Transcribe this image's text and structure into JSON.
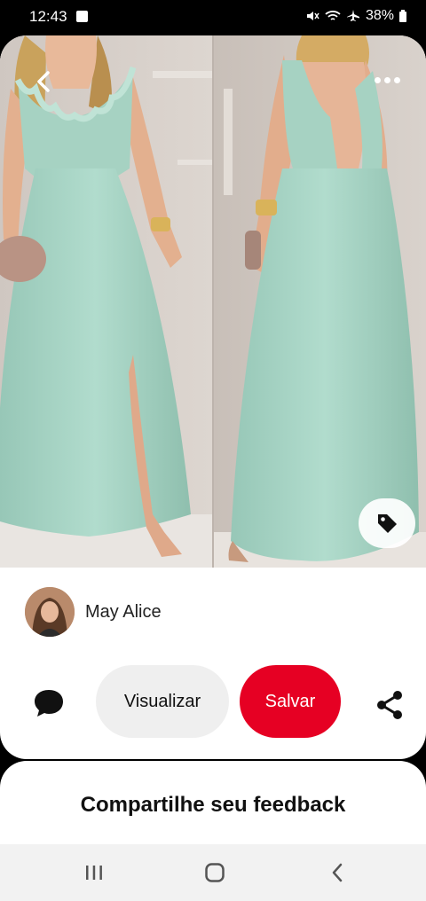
{
  "status_bar": {
    "time": "12:43",
    "battery": "38%"
  },
  "pin": {
    "author_name": "May Alice",
    "visualize_label": "Visualizar",
    "save_label": "Salvar"
  },
  "feedback": {
    "title": "Compartilhe seu feedback"
  },
  "colors": {
    "save": "#e60023",
    "dress": "#a8d3c4"
  },
  "icons": [
    "back-icon",
    "more-icon",
    "tag-icon",
    "comment-icon",
    "share-icon",
    "recents-icon",
    "home-icon",
    "nav-back-icon"
  ]
}
